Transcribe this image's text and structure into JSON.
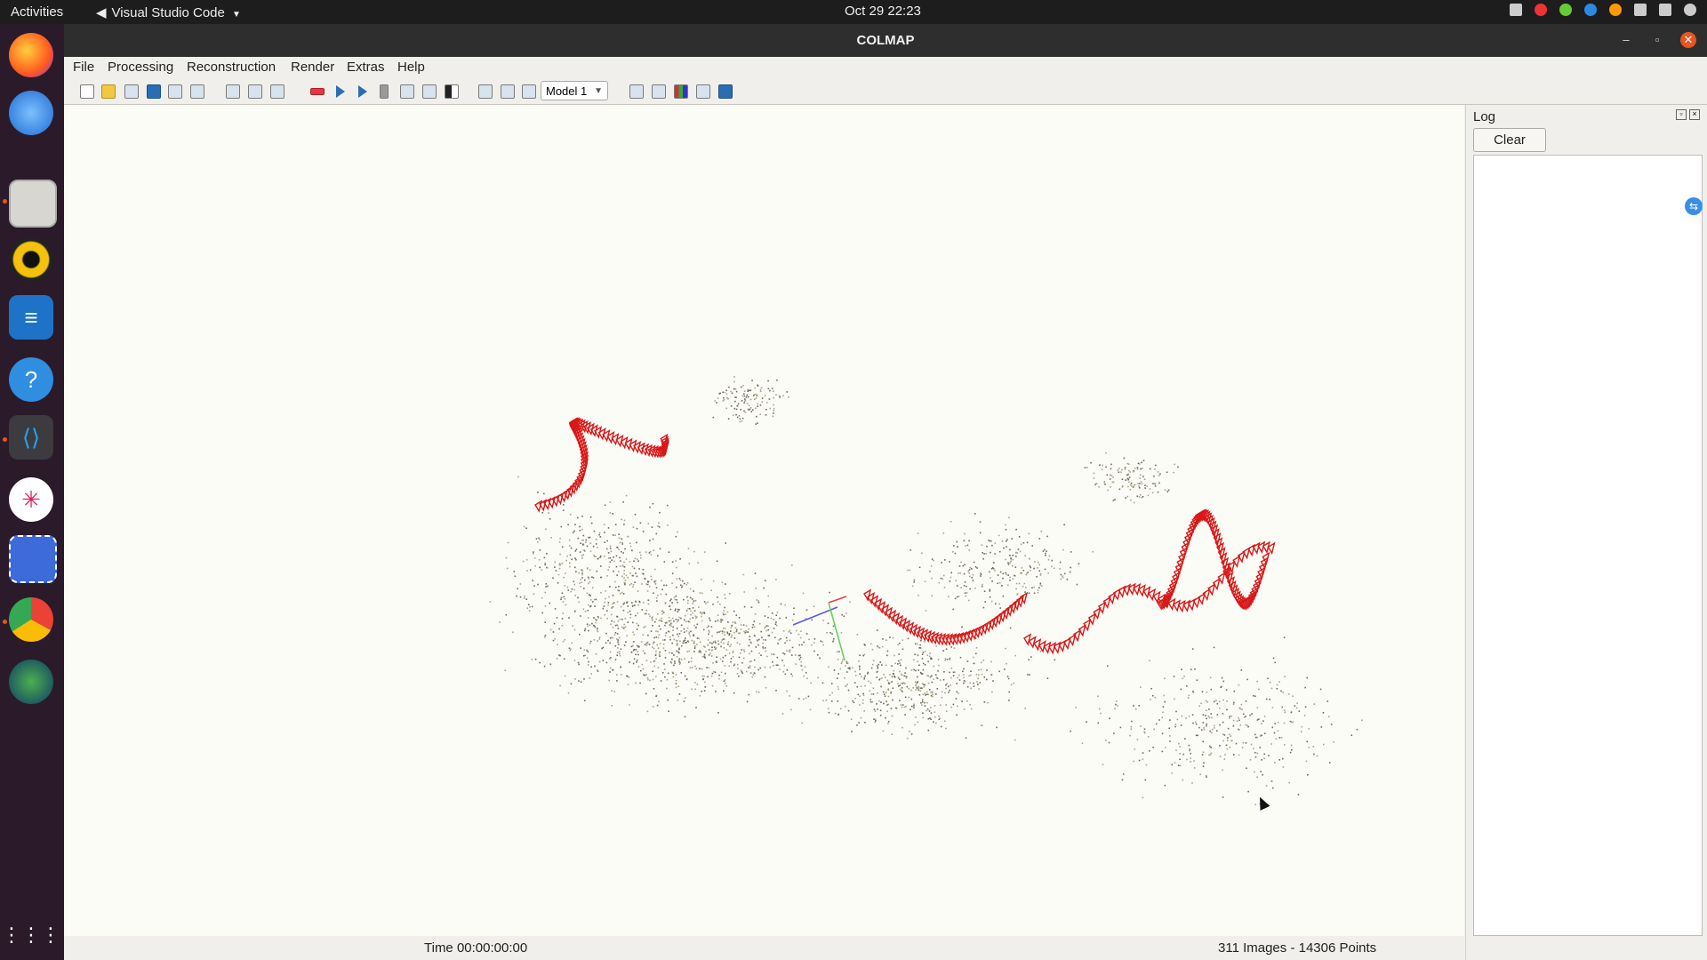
{
  "topbar": {
    "activities": "Activities",
    "app_name": "Visual Studio Code",
    "clock": "Oct 29  22:23"
  },
  "dock": {
    "items": [
      "firefox-icon",
      "thunderbird-icon",
      "files-icon",
      "rhythmbox-icon",
      "writer-icon",
      "help-icon",
      "vscode-icon",
      "slack-icon",
      "screenshot-icon",
      "chrome-icon",
      "earth-icon"
    ],
    "apps_grid_icon": "apps-grid-icon"
  },
  "window": {
    "title": "COLMAP",
    "menu": [
      "File",
      "Processing",
      "Reconstruction",
      "Render",
      "Extras",
      "Help"
    ],
    "model_select": "Model 1"
  },
  "log": {
    "title": "Log",
    "clear_label": "Clear"
  },
  "status": {
    "time": "Time 00:00:00:00",
    "counts": "311 Images - 14306 Points"
  },
  "colors": {
    "camera": "#d81818",
    "point": "#6f6a5a",
    "accent": "#e95420"
  }
}
